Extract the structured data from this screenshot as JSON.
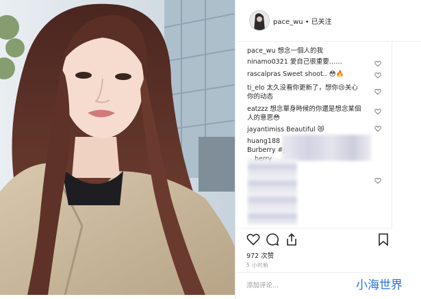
{
  "post": {
    "username": "pace_wu",
    "separator": "•",
    "follow_status": "已关注",
    "likes": "972 次赞",
    "time": "5 小时前",
    "add_comment_placeholder": "添加评论..."
  },
  "comments": [
    {
      "user": "pace_wu",
      "text": "想念一個人的我"
    },
    {
      "user": "ninamo0321",
      "text": "愛自己很重要……"
    },
    {
      "user": "rascalpras",
      "text": "Sweet shoot.. 😳🔥"
    },
    {
      "user": "ti_elo",
      "text": "太久没看你更新了，想你😢关心"
    },
    {
      "user": "",
      "text": "你的动态"
    },
    {
      "user": "eatzzz",
      "text": "想念單身時候的你還是想念某個"
    },
    {
      "user": "",
      "text": "人的意思😳"
    },
    {
      "user": "jayantimiss",
      "text": "Beautiful 😻"
    },
    {
      "user": "huang188",
      "text": ""
    },
    {
      "user": "",
      "text": "Burberry #j"
    },
    {
      "user": "",
      "text": "berry"
    }
  ],
  "watermark": "小海世界",
  "colors": {
    "text": "#262626",
    "muted": "#999999",
    "watermark": "#2a6fd6"
  },
  "icons": [
    "heart-icon",
    "comment-icon",
    "share-icon",
    "bookmark-icon"
  ]
}
